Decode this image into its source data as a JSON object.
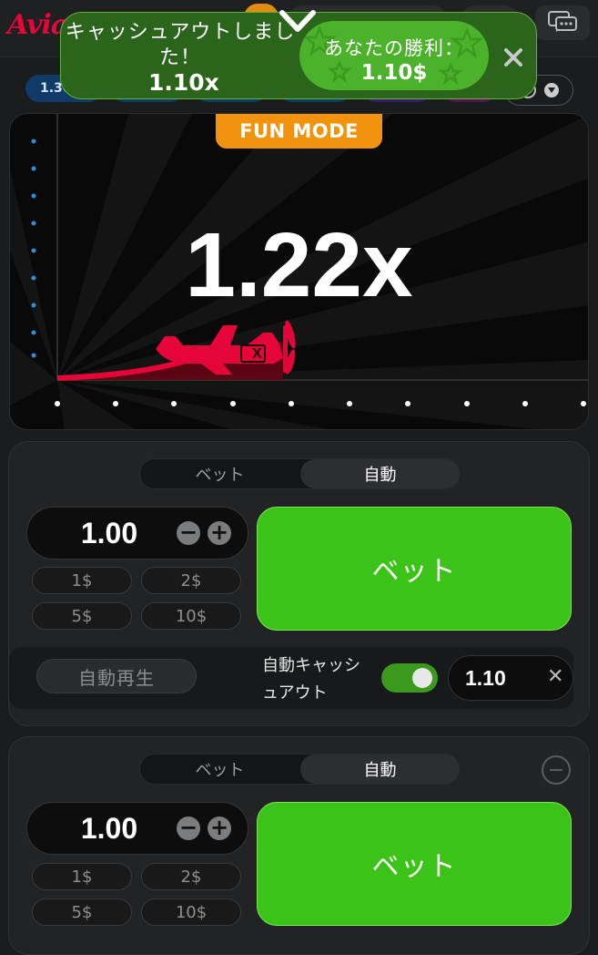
{
  "header": {
    "logo": "Avia",
    "chat_icon": "chat-bubbles-icon"
  },
  "history": {
    "chips": [
      {
        "label": "1.30x",
        "color": "#34b4ff"
      },
      {
        "label": "",
        "color": "#34b4ff"
      },
      {
        "label": "",
        "color": "#34b4ff"
      },
      {
        "label": "",
        "color": "#34b4ff"
      },
      {
        "label": "",
        "color": "#913ef8"
      },
      {
        "label": "",
        "color": "#c017b4"
      }
    ]
  },
  "notification": {
    "title": "キャッシュアウトしました！",
    "multiplier": "1.10x",
    "win_label": "あなたの勝利：",
    "win_amount": "1.10$"
  },
  "game": {
    "mode_badge": "FUN MODE",
    "multiplier": "1.22x",
    "accent": "#e50539"
  },
  "bet_panels": [
    {
      "tabs": [
        "ベット",
        "自動"
      ],
      "stake": "1.00",
      "quick_amounts": [
        "1$",
        "2$",
        "5$",
        "10$"
      ],
      "bet_label": "ベット",
      "autoplay_label": "自動再生",
      "auto_cashout_label": "自動キャッシュアウト",
      "auto_cashout_enabled": true,
      "auto_cashout_value": "1.10"
    },
    {
      "tabs": [
        "ベット",
        "自動"
      ],
      "stake": "1.00",
      "quick_amounts": [
        "1$",
        "2$",
        "5$",
        "10$"
      ],
      "bet_label": "ベット"
    }
  ]
}
